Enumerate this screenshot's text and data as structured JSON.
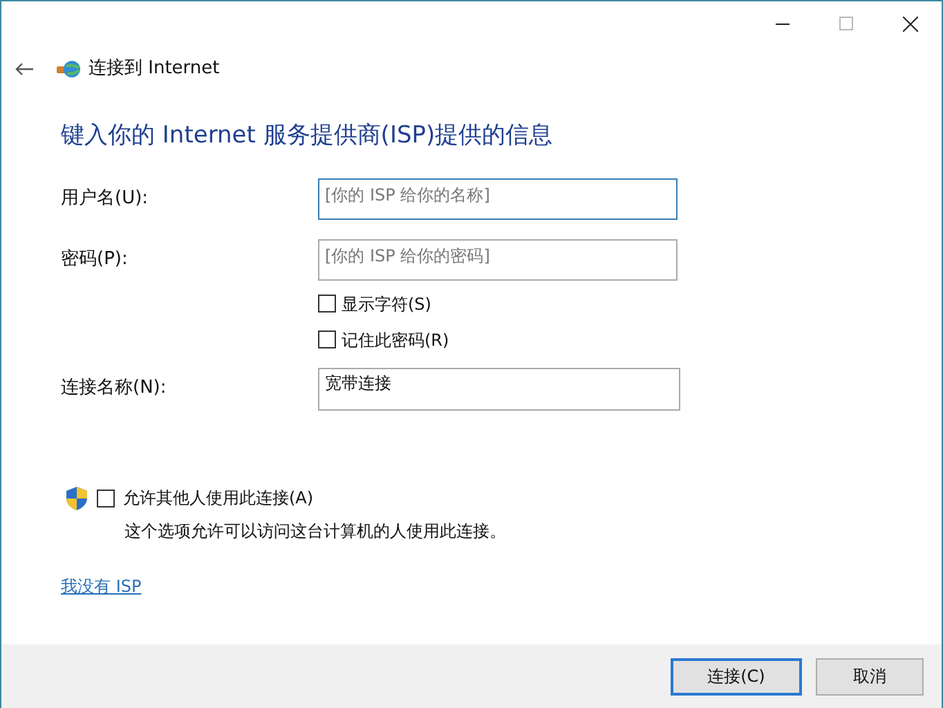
{
  "window": {
    "title": "连接到 Internet"
  },
  "heading": "键入你的 Internet 服务提供商(ISP)提供的信息",
  "fields": [
    {
      "label": "用户名(U):",
      "placeholder": "[你的 ISP 给你的名称]",
      "focused": true
    },
    {
      "label": "密码(P):",
      "placeholder": "[你的 ISP 给你的密码]",
      "focused": false
    }
  ],
  "options": [
    {
      "label": "显示字符(S)",
      "checked": false
    },
    {
      "label": "记住此密码(R)",
      "checked": false
    }
  ],
  "connection_name": {
    "label": "连接名称(N):",
    "value": "宽带连接"
  },
  "allow_others": {
    "label": "允许其他人使用此连接(A)",
    "checked": false,
    "description": "这个选项允许可以访问这台计算机的人使用此连接。"
  },
  "link": "我没有 ISP",
  "buttons": [
    {
      "label": "连接(C)",
      "default": true
    },
    {
      "label": "取消",
      "default": false
    }
  ]
}
